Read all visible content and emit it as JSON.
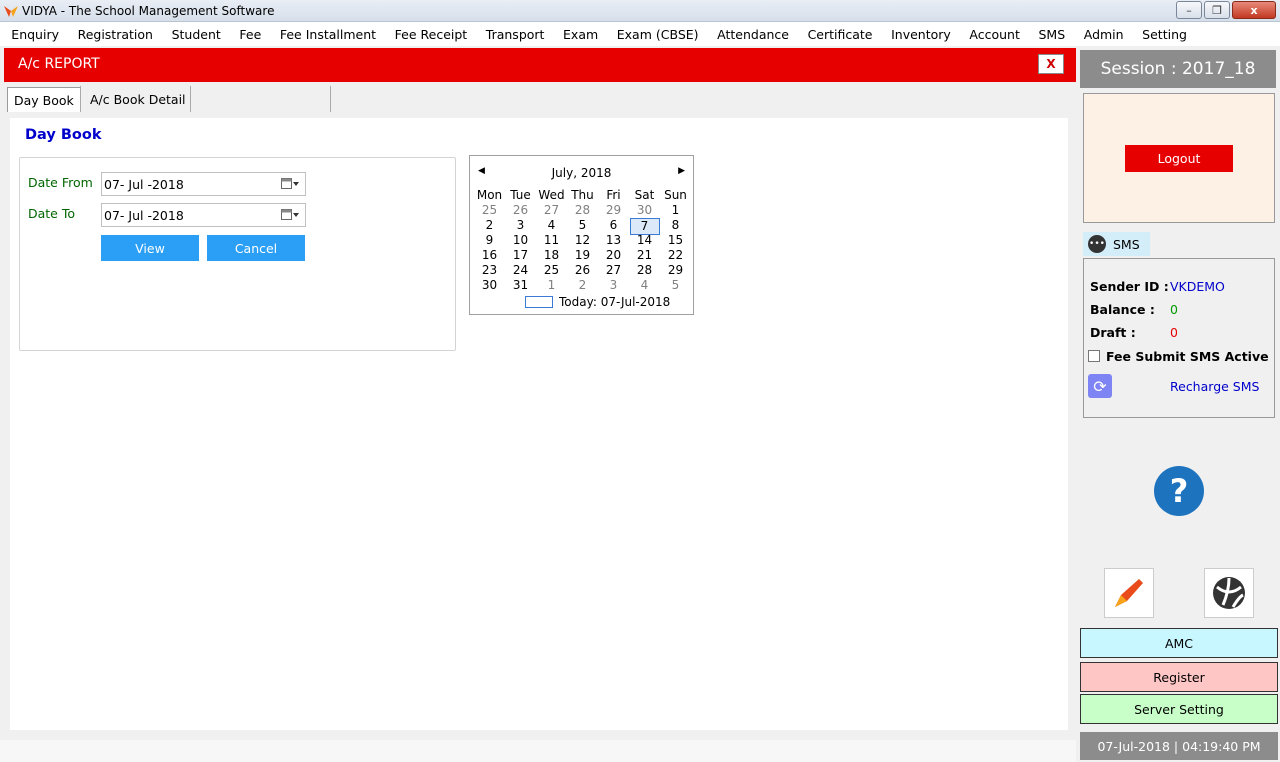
{
  "window": {
    "title": "VIDYA - The School Management Software",
    "min_icon": "minimize-icon",
    "max_icon": "maximize-icon",
    "close_label": "x"
  },
  "menu": [
    "Enquiry",
    "Registration",
    "Student",
    "Fee",
    "Fee Installment",
    "Fee Receipt",
    "Transport",
    "Exam",
    "Exam (CBSE)",
    "Attendance",
    "Certificate",
    "Inventory",
    "Account",
    "SMS",
    "Admin",
    "Setting"
  ],
  "report": {
    "title": "A/c REPORT",
    "close_label": "X",
    "accent": "#e60000"
  },
  "tabs": [
    {
      "label": "Day Book",
      "active": true
    },
    {
      "label": "A/c Book Detail",
      "active": false
    }
  ],
  "daybook": {
    "title": "Day Book",
    "date_from_label": "Date From",
    "date_from_value": "07- Jul -2018",
    "date_to_label": "Date To",
    "date_to_value": "07- Jul -2018",
    "view_label": "View",
    "cancel_label": "Cancel"
  },
  "calendar": {
    "month": "July, 2018",
    "weekdays": [
      "Mon",
      "Tue",
      "Wed",
      "Thu",
      "Fri",
      "Sat",
      "Sun"
    ],
    "weeks": [
      [
        "25",
        "26",
        "27",
        "28",
        "29",
        "30",
        "1"
      ],
      [
        "2",
        "3",
        "4",
        "5",
        "6",
        "7",
        "8"
      ],
      [
        "9",
        "10",
        "11",
        "12",
        "13",
        "14",
        "15"
      ],
      [
        "16",
        "17",
        "18",
        "19",
        "20",
        "21",
        "22"
      ],
      [
        "23",
        "24",
        "25",
        "26",
        "27",
        "28",
        "29"
      ],
      [
        "30",
        "31",
        "1",
        "2",
        "3",
        "4",
        "5"
      ]
    ],
    "muted_first_row_count": 6,
    "muted_last_row_from": 2,
    "selected": "7",
    "today_text": "Today: 07-Jul-2018"
  },
  "session": {
    "text": "Session : 2017_18"
  },
  "logout": {
    "label": "Logout"
  },
  "sms": {
    "tab_label": "SMS",
    "sender_label": "Sender ID :",
    "sender_value": "VKDEMO",
    "balance_label": "Balance :",
    "balance_value": "0",
    "draft_label": "Draft :",
    "draft_value": "0",
    "fee_submit_label": "Fee Submit SMS Active",
    "fee_submit_checked": false,
    "recharge_label": "Recharge SMS"
  },
  "side_buttons": [
    {
      "label": "AMC",
      "color": "#c8f7ff"
    },
    {
      "label": "Register",
      "color": "#ffc6c6"
    },
    {
      "label": "Server Setting",
      "color": "#c8ffc8"
    }
  ],
  "status": {
    "datetime": "07-Jul-2018 | 04:19:40 PM"
  }
}
